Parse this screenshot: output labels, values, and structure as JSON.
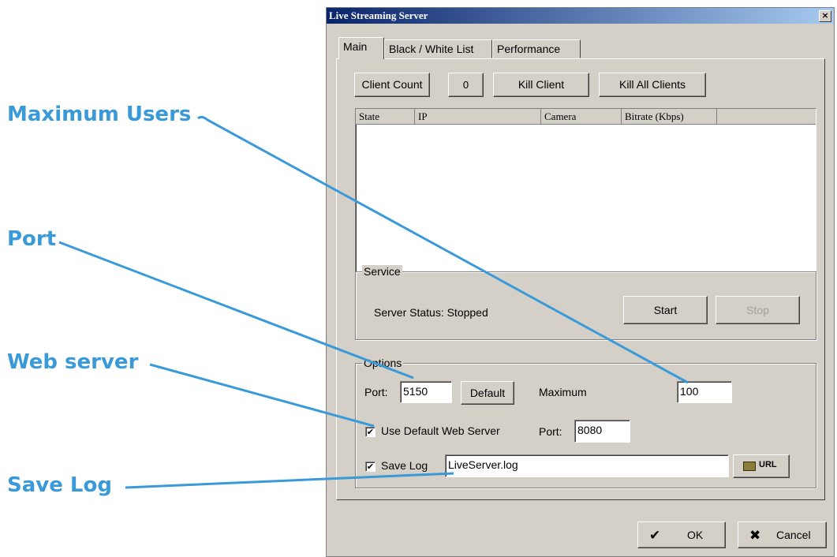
{
  "callouts": {
    "maximum_users": "Maximum Users",
    "port": "Port",
    "web_server": "Web server",
    "save_log": "Save Log",
    "color": "#3a9ad9"
  },
  "dialog": {
    "title": "Live Streaming Server",
    "close": "×",
    "tabs": [
      "Main",
      "Black / White List",
      "Performance"
    ],
    "client_count_label": "Client Count",
    "client_count_value": "0",
    "kill_client": "Kill Client",
    "kill_all_clients": "Kill All Clients",
    "columns": [
      "State",
      "IP",
      "Camera",
      "Bitrate (Kbps)"
    ],
    "service": {
      "title": "Service",
      "status": "Server Status: Stopped",
      "start": "Start",
      "stop": "Stop"
    },
    "options": {
      "title": "Options",
      "port_label": "Port:",
      "port_value": "5150",
      "default_button": "Default",
      "maximum_label": "Maximum",
      "maximum_value": "100",
      "use_default_web_server": "Use Default Web Server",
      "use_default_web_server_checked": true,
      "web_port_label": "Port:",
      "web_port_value": "8080",
      "save_log": "Save Log",
      "save_log_checked": true,
      "log_file": "LiveServer.log",
      "url_button": "URL",
      "check_mark": "✔"
    },
    "ok": "OK",
    "cancel": "Cancel",
    "ok_icon": "✔",
    "cancel_icon": "✖"
  }
}
